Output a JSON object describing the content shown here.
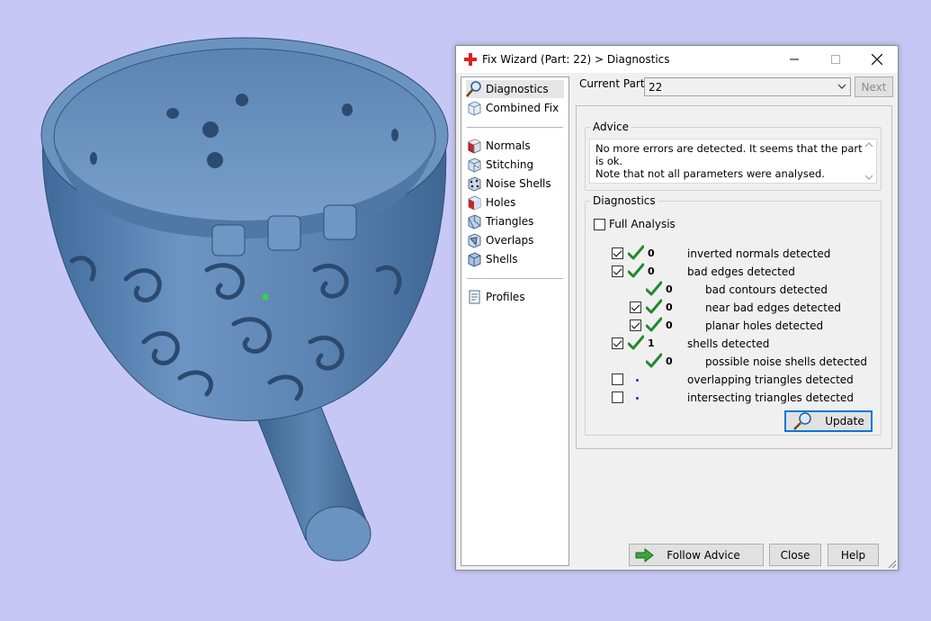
{
  "window": {
    "title": "Fix Wizard (Part: 22) > Diagnostics",
    "close_symbol": "✕"
  },
  "sidebar": {
    "items": [
      {
        "label": "Diagnostics",
        "icon": "magnifier-icon"
      },
      {
        "label": "Combined Fix",
        "icon": "combined-fix-icon"
      },
      {
        "label": "Normals",
        "icon": "normals-cube-icon"
      },
      {
        "label": "Stitching",
        "icon": "stitching-icon"
      },
      {
        "label": "Noise Shells",
        "icon": "noise-shells-icon"
      },
      {
        "label": "Holes",
        "icon": "holes-icon"
      },
      {
        "label": "Triangles",
        "icon": "triangles-icon"
      },
      {
        "label": "Overlaps",
        "icon": "overlaps-icon"
      },
      {
        "label": "Shells",
        "icon": "shells-icon"
      },
      {
        "label": "Profiles",
        "icon": "profiles-icon"
      }
    ],
    "selected": "Diagnostics"
  },
  "current_part": {
    "label": "Current Part:",
    "value": "22",
    "next_label": "Next"
  },
  "advice": {
    "legend": "Advice",
    "line1": "No more errors are detected. It seems that the part is ok.",
    "line2": "Note that not all parameters were analysed."
  },
  "diagnostics": {
    "legend": "Diagnostics",
    "full_analysis_label": "Full Analysis",
    "full_analysis_checked": false,
    "rows": [
      {
        "checked": true,
        "status": "ok",
        "count": "0",
        "label": "inverted normals detected",
        "indent": 0
      },
      {
        "checked": true,
        "status": "ok",
        "count": "0",
        "label": "bad edges detected",
        "indent": 0
      },
      {
        "checked": null,
        "status": "ok",
        "count": "0",
        "label": "bad contours detected",
        "indent": 1
      },
      {
        "checked": true,
        "status": "ok",
        "count": "0",
        "label": "near bad edges detected",
        "indent": 1
      },
      {
        "checked": true,
        "status": "ok",
        "count": "0",
        "label": "planar holes detected",
        "indent": 1
      },
      {
        "checked": true,
        "status": "ok",
        "count": "1",
        "label": "shells detected",
        "indent": 0
      },
      {
        "checked": null,
        "status": "ok",
        "count": "0",
        "label": "possible noise shells detected",
        "indent": 1
      },
      {
        "checked": false,
        "status": "pending",
        "count": "",
        "label": "overlapping triangles detected",
        "indent": 0
      },
      {
        "checked": false,
        "status": "pending",
        "count": "",
        "label": "intersecting triangles detected",
        "indent": 0
      }
    ],
    "update_label": "Update"
  },
  "footer": {
    "follow_advice_label": "Follow Advice",
    "close_label": "Close",
    "help_label": "Help"
  },
  "colors": {
    "background": "#c7c7f5",
    "model": "#5d86b4",
    "tick_green": "#1f8a2c"
  }
}
